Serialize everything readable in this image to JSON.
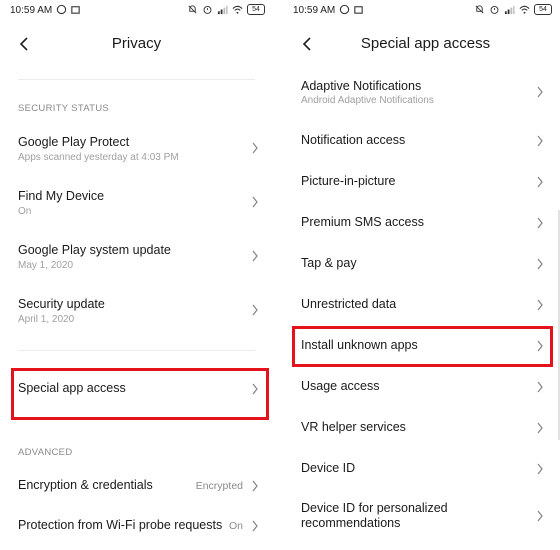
{
  "status_bar": {
    "time": "10:59 AM",
    "battery": "54"
  },
  "left": {
    "title": "Privacy",
    "section_security": "SECURITY STATUS",
    "items": [
      {
        "title": "Google Play Protect",
        "subtitle": "Apps scanned yesterday at 4:03 PM"
      },
      {
        "title": "Find My Device",
        "subtitle": "On"
      },
      {
        "title": "Google Play system update",
        "subtitle": "May 1, 2020"
      },
      {
        "title": "Security update",
        "subtitle": "April 1, 2020"
      }
    ],
    "special_app_access": "Special app access",
    "section_advanced": "ADVANCED",
    "advanced_items": [
      {
        "title": "Encryption & credentials",
        "value": "Encrypted"
      },
      {
        "title": "Protection from Wi-Fi probe requests",
        "value": "On"
      }
    ]
  },
  "right": {
    "title": "Special app access",
    "items": [
      {
        "title": "Adaptive Notifications",
        "subtitle": "Android Adaptive Notifications"
      },
      {
        "title": "Notification access"
      },
      {
        "title": "Picture-in-picture"
      },
      {
        "title": "Premium SMS access"
      },
      {
        "title": "Tap & pay"
      },
      {
        "title": "Unrestricted data"
      },
      {
        "title": "Install unknown apps"
      },
      {
        "title": "Usage access"
      },
      {
        "title": "VR helper services"
      },
      {
        "title": "Device ID"
      },
      {
        "title": "Device ID for personalized",
        "title_line2": "recommendations"
      }
    ]
  },
  "colors": {
    "highlight": "#e5121c",
    "subtitle": "#a0a0a0",
    "section_header": "#8a8a8a"
  }
}
